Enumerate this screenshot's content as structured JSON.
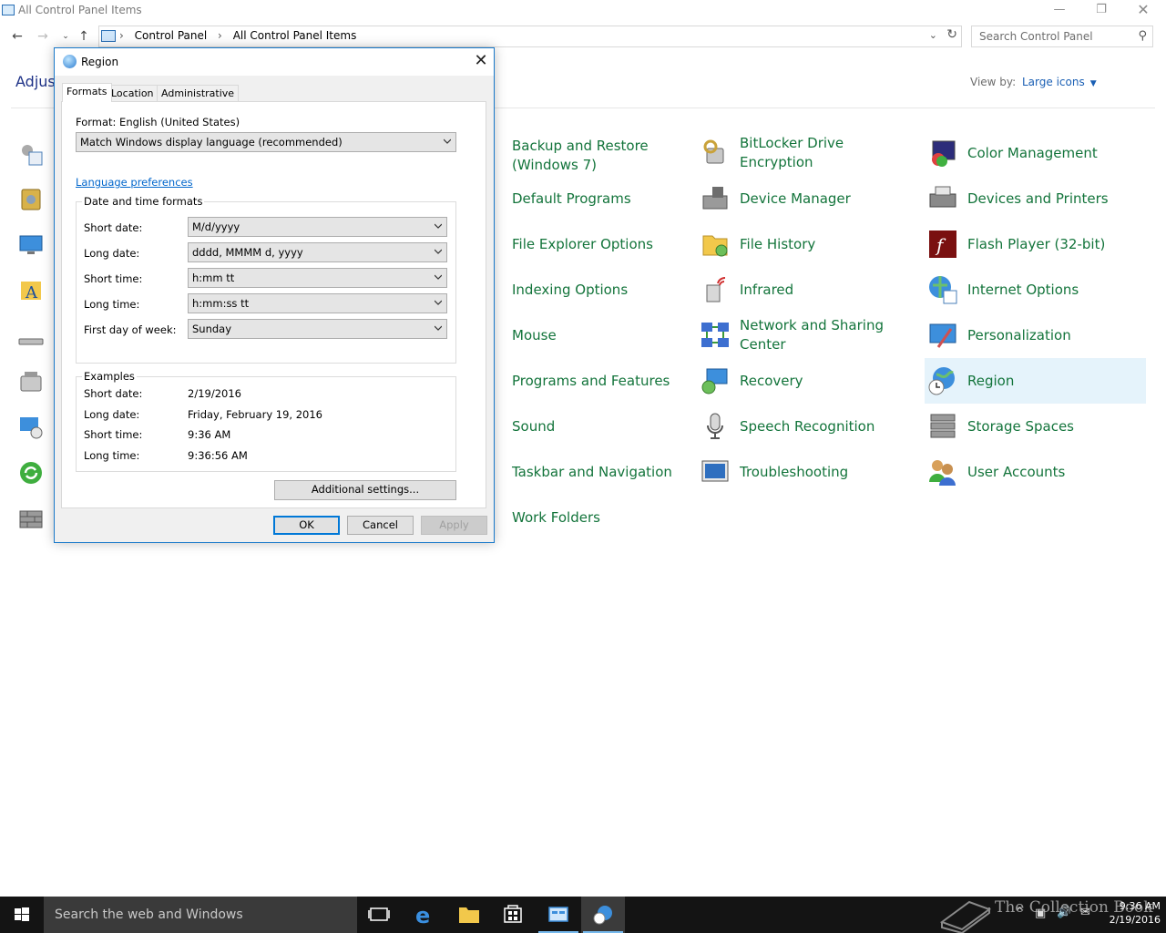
{
  "window": {
    "title": "All Control Panel Items",
    "breadcrumb": [
      "Control Panel",
      "All Control Panel Items"
    ],
    "search_placeholder": "Search Control Panel",
    "heading_partial": "Adjust",
    "view_by_label": "View by:",
    "view_by_value": "Large icons"
  },
  "items": [
    {
      "label": "Backup and Restore (Windows 7)",
      "icon": "backup-icon"
    },
    {
      "label": "BitLocker Drive Encryption",
      "icon": "bitlocker-icon"
    },
    {
      "label": "Color Management",
      "icon": "color-management-icon"
    },
    {
      "label": "Default Programs",
      "icon": "default-programs-icon"
    },
    {
      "label": "Device Manager",
      "icon": "device-manager-icon"
    },
    {
      "label": "Devices and Printers",
      "icon": "printer-icon"
    },
    {
      "label": "File Explorer Options",
      "icon": "folder-options-icon"
    },
    {
      "label": "File History",
      "icon": "file-history-icon"
    },
    {
      "label": "Flash Player (32-bit)",
      "icon": "flash-icon"
    },
    {
      "label": "Indexing Options",
      "icon": "indexing-icon"
    },
    {
      "label": "Infrared",
      "icon": "infrared-icon"
    },
    {
      "label": "Internet Options",
      "icon": "internet-options-icon"
    },
    {
      "label": "Mouse",
      "icon": "mouse-icon"
    },
    {
      "label": "Network and Sharing Center",
      "icon": "network-icon"
    },
    {
      "label": "Personalization",
      "icon": "personalization-icon"
    },
    {
      "label": "Programs and Features",
      "icon": "programs-icon"
    },
    {
      "label": "Recovery",
      "icon": "recovery-icon"
    },
    {
      "label": "Region",
      "icon": "region-icon",
      "selected": true
    },
    {
      "label": "Sound",
      "icon": "sound-icon"
    },
    {
      "label": "Speech Recognition",
      "icon": "microphone-icon"
    },
    {
      "label": "Storage Spaces",
      "icon": "storage-icon"
    },
    {
      "label": "Taskbar and Navigation",
      "icon": "taskbar-icon"
    },
    {
      "label": "Troubleshooting",
      "icon": "troubleshooting-icon"
    },
    {
      "label": "User Accounts",
      "icon": "users-icon"
    },
    {
      "label": "Work Folders",
      "icon": "work-folders-icon"
    }
  ],
  "dialog": {
    "title": "Region",
    "tabs": [
      "Formats",
      "Location",
      "Administrative"
    ],
    "format_label": "Format: English (United States)",
    "format_value": "Match Windows display language (recommended)",
    "language_link": "Language preferences",
    "dt_group_title": "Date and time formats",
    "fields": [
      {
        "label": "Short date:",
        "value": "M/d/yyyy"
      },
      {
        "label": "Long date:",
        "value": "dddd, MMMM d, yyyy"
      },
      {
        "label": "Short time:",
        "value": "h:mm tt"
      },
      {
        "label": "Long time:",
        "value": "h:mm:ss tt"
      },
      {
        "label": "First day of week:",
        "value": "Sunday"
      }
    ],
    "examples_title": "Examples",
    "examples": [
      {
        "label": "Short date:",
        "value": "2/19/2016"
      },
      {
        "label": "Long date:",
        "value": "Friday, February 19, 2016"
      },
      {
        "label": "Short time:",
        "value": "9:36 AM"
      },
      {
        "label": "Long time:",
        "value": "9:36:56 AM"
      }
    ],
    "additional_settings": "Additional settings...",
    "ok": "OK",
    "cancel": "Cancel",
    "apply": "Apply"
  },
  "taskbar": {
    "search_placeholder": "Search the web and Windows",
    "clock_time": "9:36 AM",
    "clock_date": "2/19/2016",
    "watermark": "The Collection Book"
  },
  "colors": {
    "item_text": "#13743b",
    "link": "#0066cc",
    "selection": "#e5f3fb",
    "dialog_border": "#1979ca",
    "taskbar": "#141414"
  }
}
